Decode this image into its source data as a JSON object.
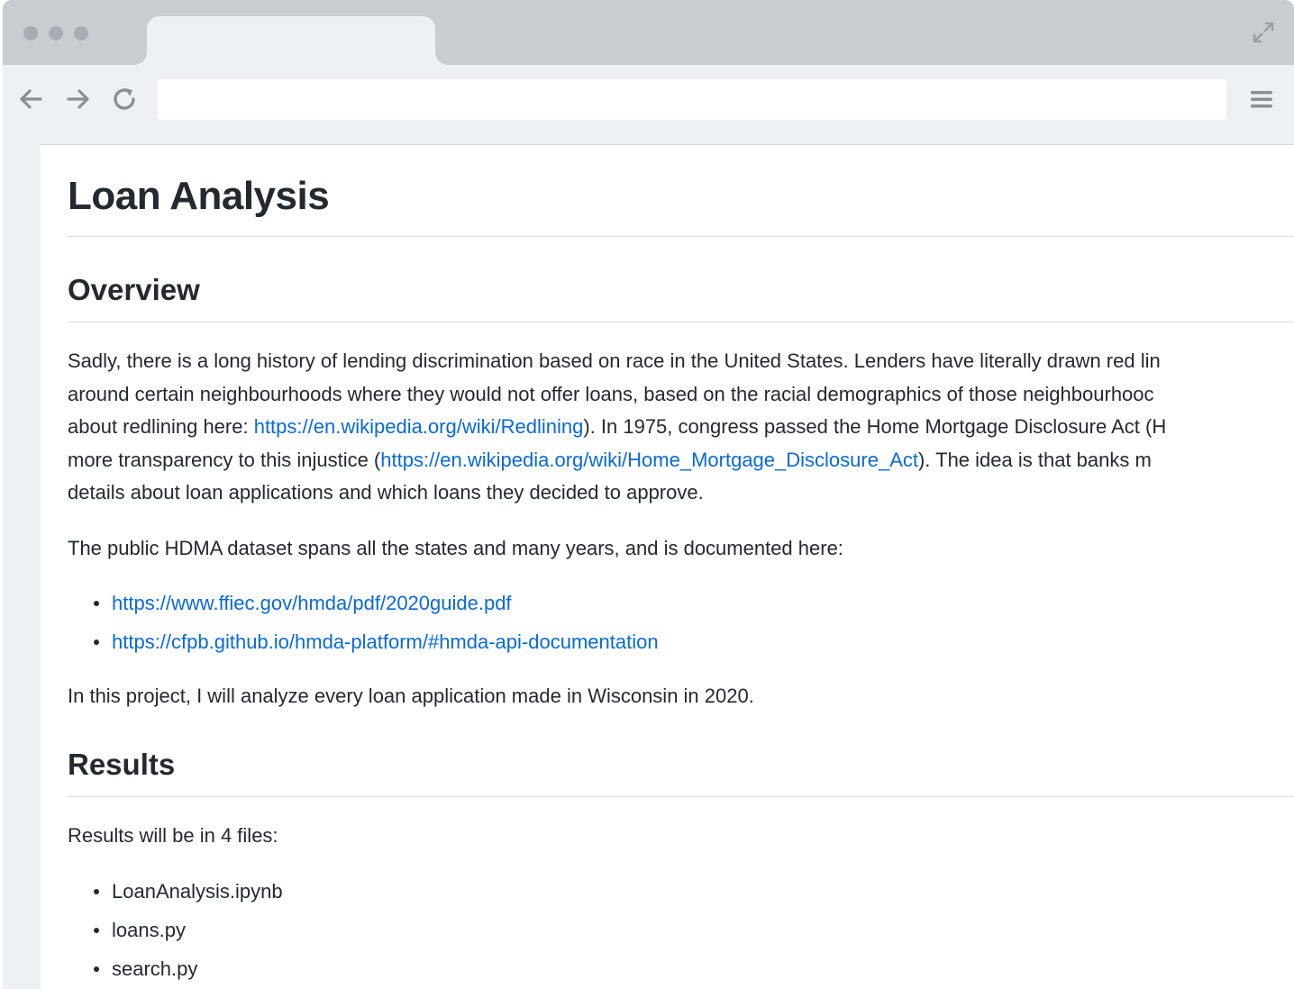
{
  "browser": {
    "address_value": ""
  },
  "page": {
    "title": "Loan Analysis",
    "overview": {
      "heading": "Overview",
      "para1": {
        "line1": "Sadly, there is a long history of lending discrimination based on race in the United States. Lenders have literally drawn red lin",
        "line2": "around certain neighbourhoods where they would not offer loans, based on the racial demographics of those neighbourhooc",
        "line3_pre": "about redlining here: ",
        "line3_link": "https://en.wikipedia.org/wiki/Redlining",
        "line3_post": "). In 1975, congress passed the Home Mortgage Disclosure Act (H",
        "line4_pre": "more transparency to this injustice (",
        "line4_link": "https://en.wikipedia.org/wiki/Home_Mortgage_Disclosure_Act",
        "line4_post": "). The idea is that banks m",
        "line5": "details about loan applications and which loans they decided to approve."
      },
      "para2": "The public HDMA dataset spans all the states and many years, and is documented here:",
      "links": [
        "https://www.ffiec.gov/hmda/pdf/2020guide.pdf",
        "https://cfpb.github.io/hmda-platform/#hmda-api-documentation"
      ],
      "para3": "In this project, I will analyze every loan application made in Wisconsin in 2020."
    },
    "results": {
      "heading": "Results",
      "intro": "Results will be in 4 files:",
      "files": [
        "LoanAnalysis.ipynb",
        "loans.py",
        "search.py"
      ]
    }
  }
}
